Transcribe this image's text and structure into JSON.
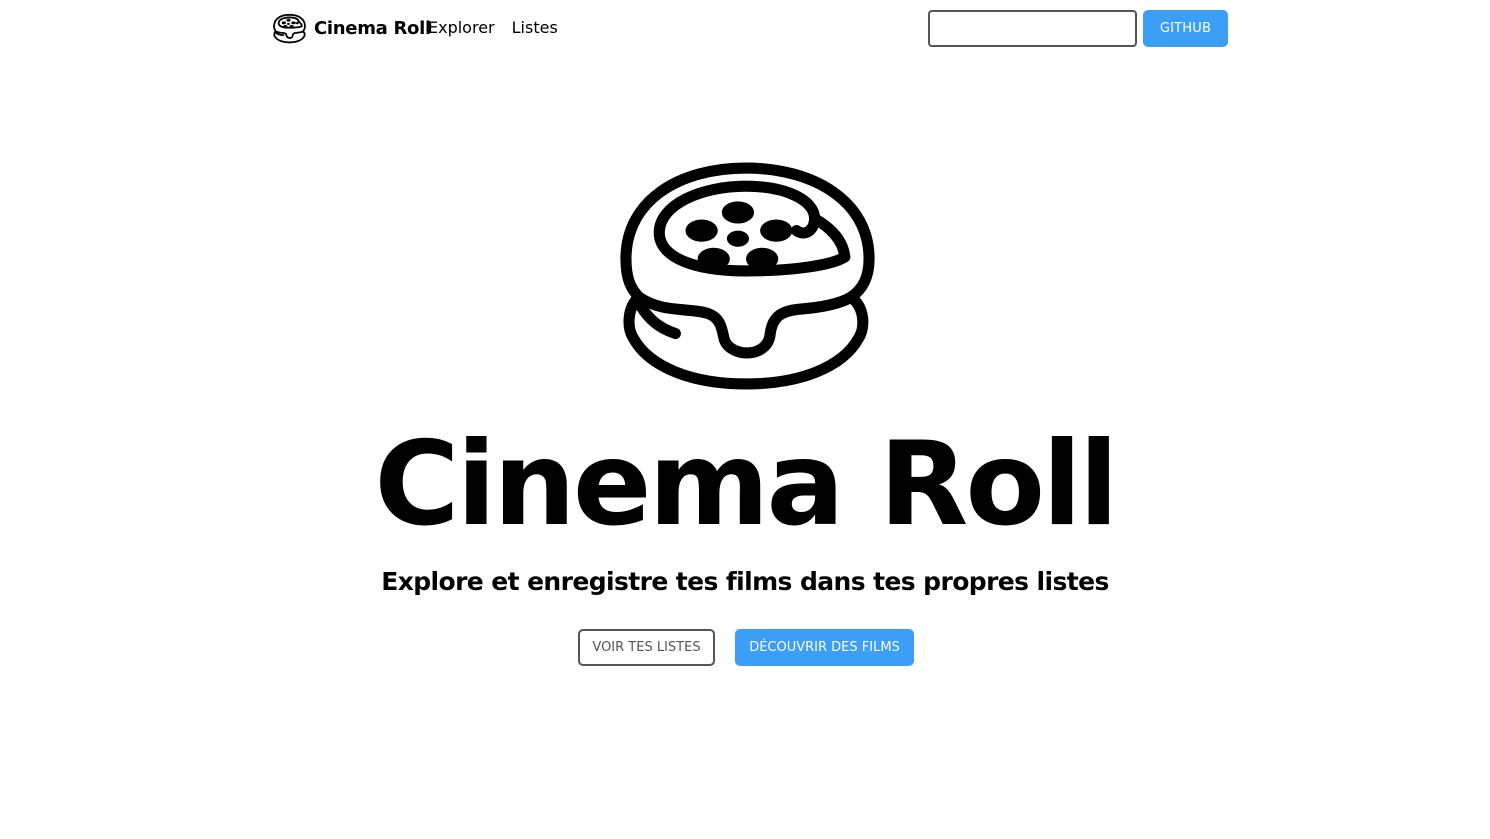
{
  "navbar": {
    "brand_name": "Cinema Roll",
    "logo_icon": "cinnamon-roll-film-reel-icon",
    "links": [
      {
        "label": "Explorer"
      },
      {
        "label": "Listes"
      }
    ],
    "search": {
      "value": "",
      "placeholder": ""
    },
    "github_label": "GITHUB"
  },
  "hero": {
    "logo_icon": "cinnamon-roll-film-reel-icon",
    "title": "Cinema Roll",
    "subtitle": "Explore et enregistre tes films dans tes propres listes",
    "secondary_button_label": "VOIR TES LISTES",
    "primary_button_label": "DÉCOUVRIR DES FILMS"
  },
  "colors": {
    "accent": "#3b9ef7",
    "text": "#000000",
    "outline": "#555555",
    "background": "#ffffff"
  }
}
